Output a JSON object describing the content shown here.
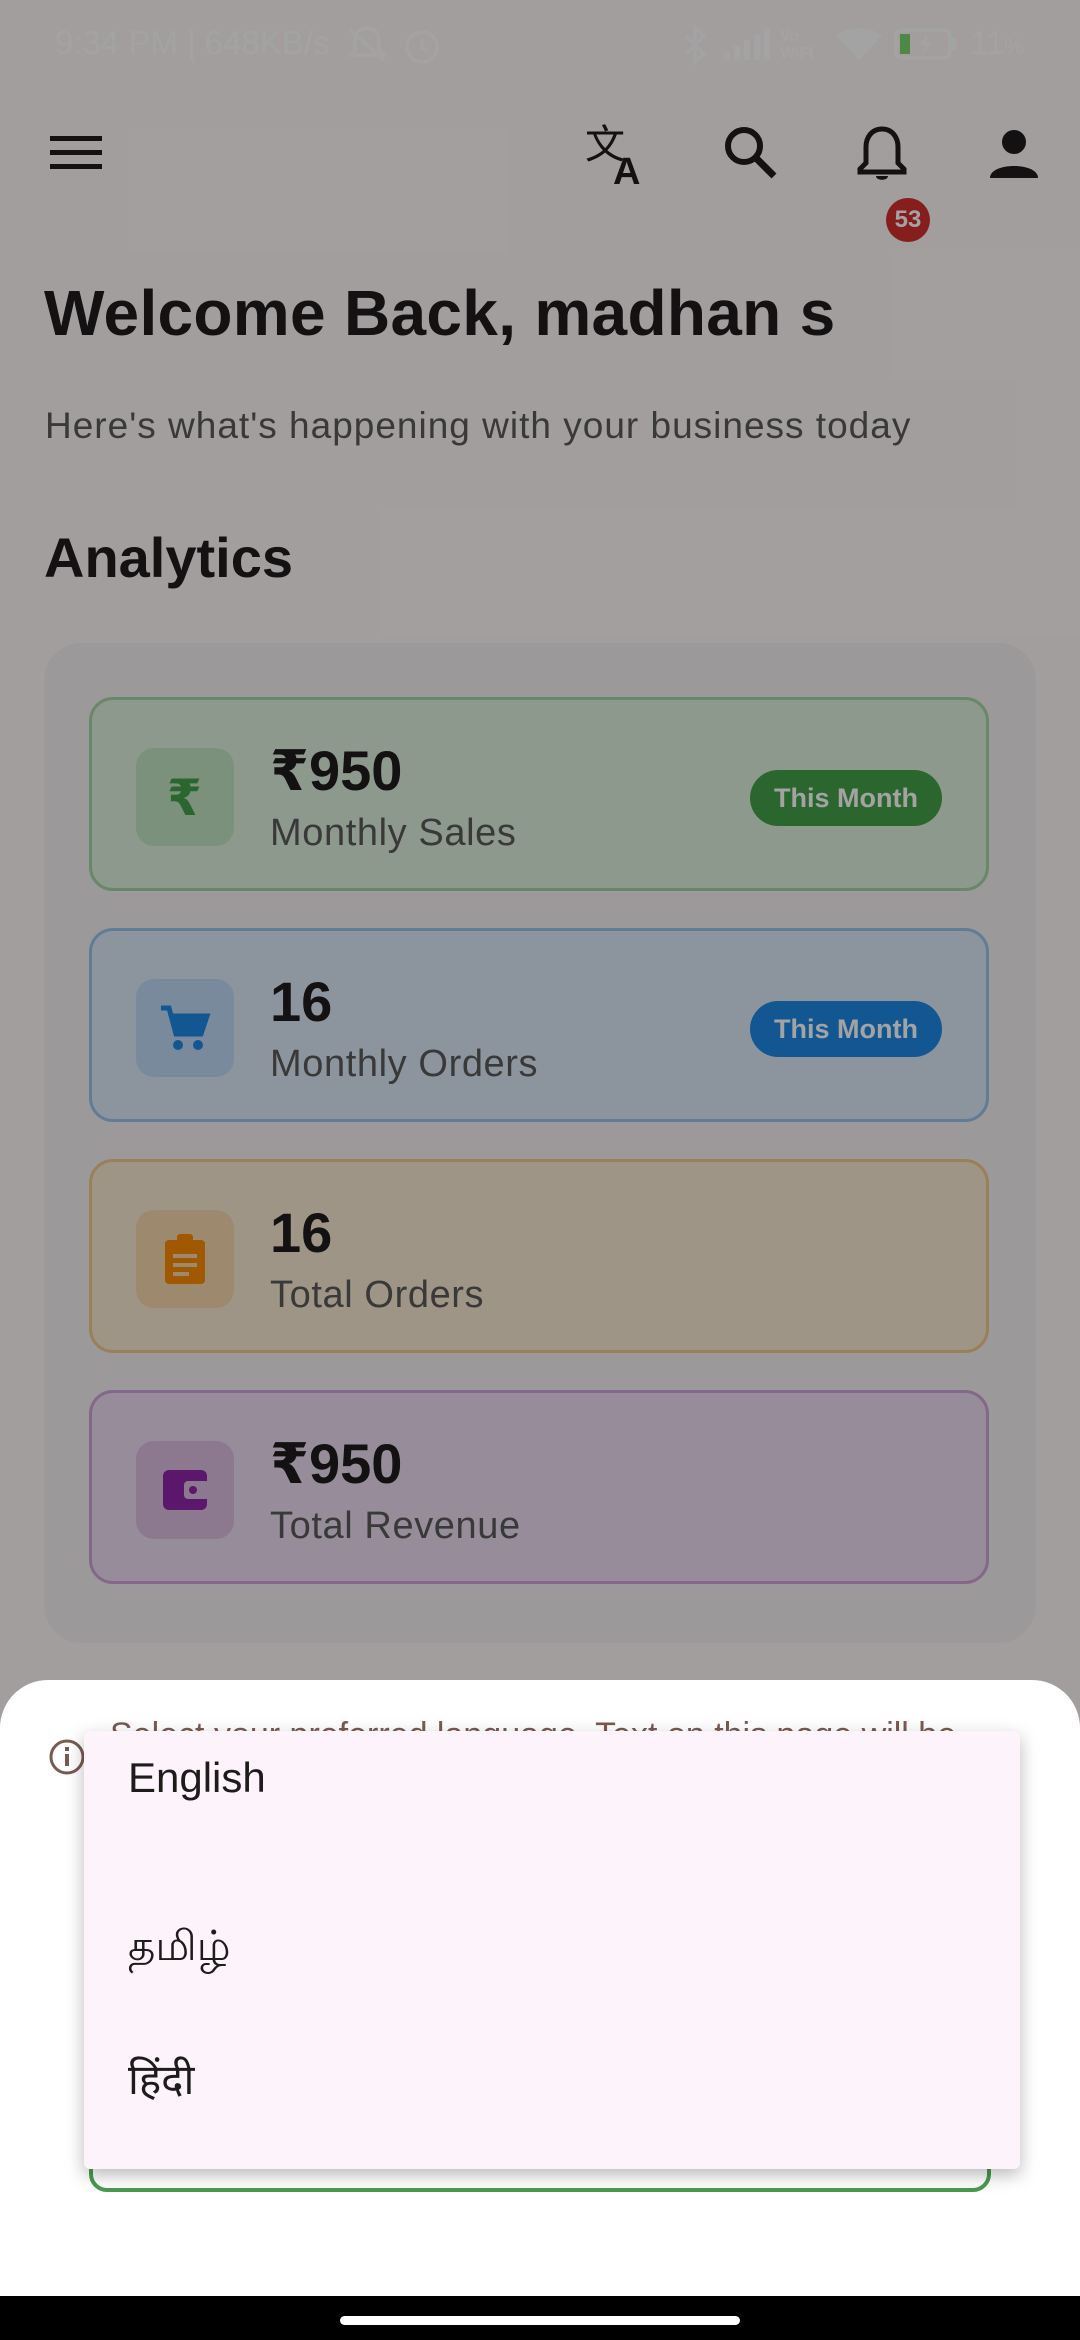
{
  "status_bar": {
    "time_speed": "9:34 PM | 648KB/s",
    "vowifi": "Vo WiFi",
    "battery": "11"
  },
  "app_bar": {
    "notification_count": "53",
    "icons": [
      "menu-icon",
      "translate-icon",
      "search-icon",
      "bell-icon",
      "account-icon"
    ]
  },
  "header": {
    "welcome": "Welcome Back, madhan s",
    "subtitle": "Here's what's happening with your business today",
    "section_title": "Analytics"
  },
  "cards": [
    {
      "value": "₹950",
      "label": "Monthly Sales",
      "tag": "This Month",
      "icon": "rupee-icon",
      "color": "#43a047"
    },
    {
      "value": "16",
      "label": "Monthly Orders",
      "tag": "This Month",
      "icon": "cart-icon",
      "color": "#1e88e5"
    },
    {
      "value": "16",
      "label": "Total Orders",
      "tag": "",
      "icon": "clipboard-icon",
      "color": "#fb8c00"
    },
    {
      "value": "₹950",
      "label": "Total Revenue",
      "tag": "",
      "icon": "wallet-icon",
      "color": "#8e24aa"
    }
  ],
  "language_sheet": {
    "note": "Select your preferred language. Text on this page will be",
    "options": [
      "English",
      "தமிழ்",
      "हिंदी"
    ]
  }
}
